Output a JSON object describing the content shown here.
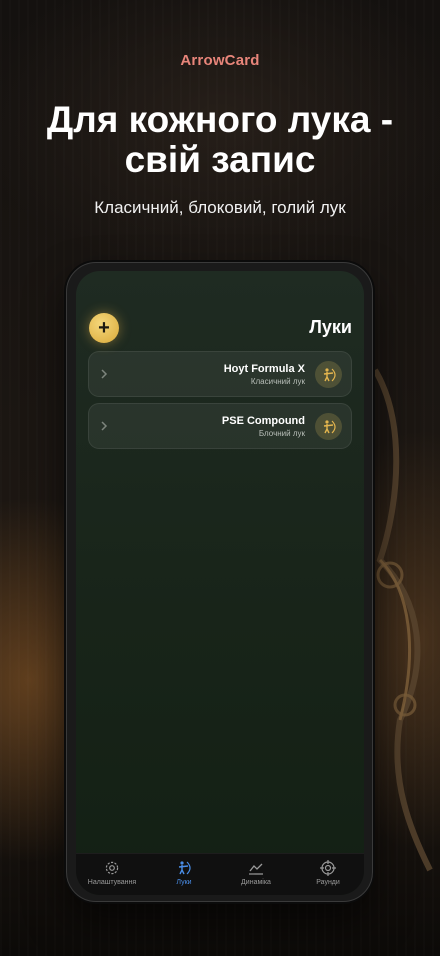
{
  "brand": "ArrowCard",
  "headline_line1": "Для кожного лука -",
  "headline_line2": "свій запис",
  "subline": "Класичний, блоковий, голий лук",
  "screen": {
    "title": "Луки",
    "add_label": "+",
    "bows": [
      {
        "name": "Hoyt Formula X",
        "type": "Класичний лук",
        "icon": "archer-icon"
      },
      {
        "name": "PSE Compound",
        "type": "Блочний лук",
        "icon": "archer-icon"
      }
    ]
  },
  "tabs": [
    {
      "label": "Налаштування",
      "icon": "gear-icon",
      "active": false
    },
    {
      "label": "Луки",
      "icon": "archer-icon",
      "active": true
    },
    {
      "label": "Динаміка",
      "icon": "chart-icon",
      "active": false
    },
    {
      "label": "Раунди",
      "icon": "target-icon",
      "active": false
    }
  ],
  "colors": {
    "brand": "#e8857a",
    "accent_gold": "#e3b54e",
    "tab_active": "#4a8ee8",
    "screen_bg": "#1b271c"
  }
}
